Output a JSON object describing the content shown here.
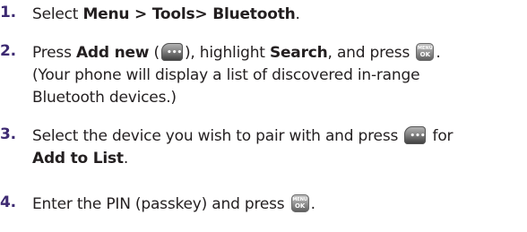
{
  "steps": [
    {
      "number": "1.",
      "line1_pre": "Select ",
      "line1_bold": "Menu > Tools> Bluetooth",
      "line1_post": "."
    },
    {
      "number": "2.",
      "press": "Press ",
      "add_new": "Add new",
      "paren_open": " (",
      "paren_close": "), highlight ",
      "search": "Search",
      "and_press": ", and press ",
      "end": ".",
      "line2": "(Your phone will display a list of discovered in-range",
      "line3": "Bluetooth devices.)"
    },
    {
      "number": "3.",
      "line1_pre": "Select the device you wish to pair with and press ",
      "line1_post": " for",
      "line2_bold": "Add to List",
      "line2_post": "."
    },
    {
      "number": "4.",
      "line1_pre": "Enter the PIN (passkey) and press ",
      "line1_post": "."
    }
  ],
  "icons": {
    "soft_key": "soft-key-icon",
    "menu_ok_key": "menu-ok-key-icon",
    "menu_label": "MENU",
    "ok_label": "OK"
  },
  "colors": {
    "number": "#3d2a72",
    "text": "#231f20"
  }
}
